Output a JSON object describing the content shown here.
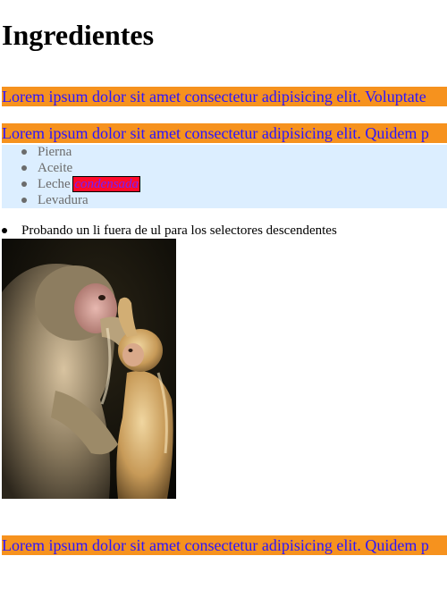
{
  "heading": "Ingredientes",
  "banners": [
    "Lorem ipsum dolor sit amet consectetur adipisicing elit. Voluptate",
    "Lorem ipsum dolor sit amet consectetur adipisicing elit. Quidem p",
    "Lorem ipsum dolor sit amet consectetur adipisicing elit. Quidem p"
  ],
  "ingredients": {
    "items": [
      {
        "label": "Pierna"
      },
      {
        "label": "Aceite"
      },
      {
        "label": "Leche ",
        "highlight": "condensada"
      },
      {
        "label": "Levadura"
      }
    ]
  },
  "outside_item": "Probando un li fuera de ul para los selectores descendentes",
  "colors": {
    "banner_bg": "#f6921e",
    "banner_text": "#2b14ff",
    "list_bg": "#dceeff",
    "highlight_bg": "#ff0a2a",
    "highlight_text": "#7020ff"
  }
}
